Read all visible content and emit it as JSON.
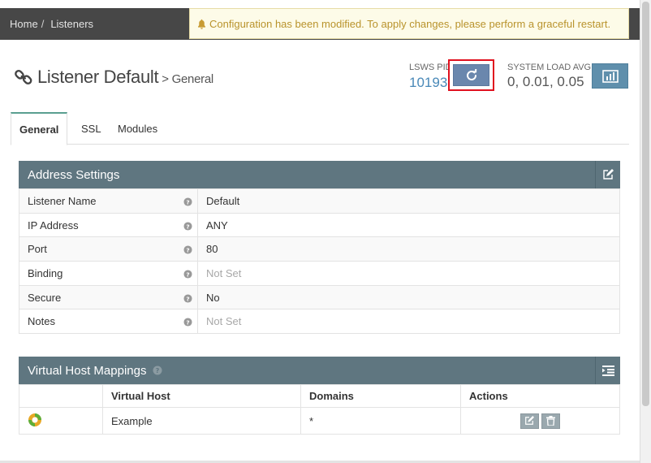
{
  "breadcrumb": {
    "home": "Home",
    "sep": "/",
    "current": "Listeners"
  },
  "notice": {
    "text": "Configuration has been modified. To apply changes, please perform a graceful restart.",
    "icon": "bell-icon"
  },
  "header": {
    "title": "Listener Default",
    "subtitle": "> General",
    "pid_label": "LSWS PID",
    "pid_value": "10193",
    "load_label": "SYSTEM LOAD AVG",
    "load_value": "0, 0.01, 0.05"
  },
  "tabs": [
    {
      "label": "General",
      "active": true
    },
    {
      "label": "SSL",
      "active": false
    },
    {
      "label": "Modules",
      "active": false
    }
  ],
  "address_settings": {
    "title": "Address Settings",
    "rows": [
      {
        "label": "Listener Name",
        "value": "Default",
        "muted": false
      },
      {
        "label": "IP Address",
        "value": "ANY",
        "muted": false
      },
      {
        "label": "Port",
        "value": "80",
        "muted": false
      },
      {
        "label": "Binding",
        "value": "Not Set",
        "muted": true
      },
      {
        "label": "Secure",
        "value": "No",
        "muted": false
      },
      {
        "label": "Notes",
        "value": "Not Set",
        "muted": true
      }
    ]
  },
  "vhost_mappings": {
    "title": "Virtual Host Mappings",
    "columns": [
      "",
      "Virtual Host",
      "Domains",
      "Actions"
    ],
    "rows": [
      {
        "vhost": "Example",
        "domains": "*"
      }
    ]
  },
  "colors": {
    "accent": "#5a9f90",
    "panel_header": "#5f7680",
    "notice_text": "#b9932c",
    "pid": "#4a89b8"
  }
}
